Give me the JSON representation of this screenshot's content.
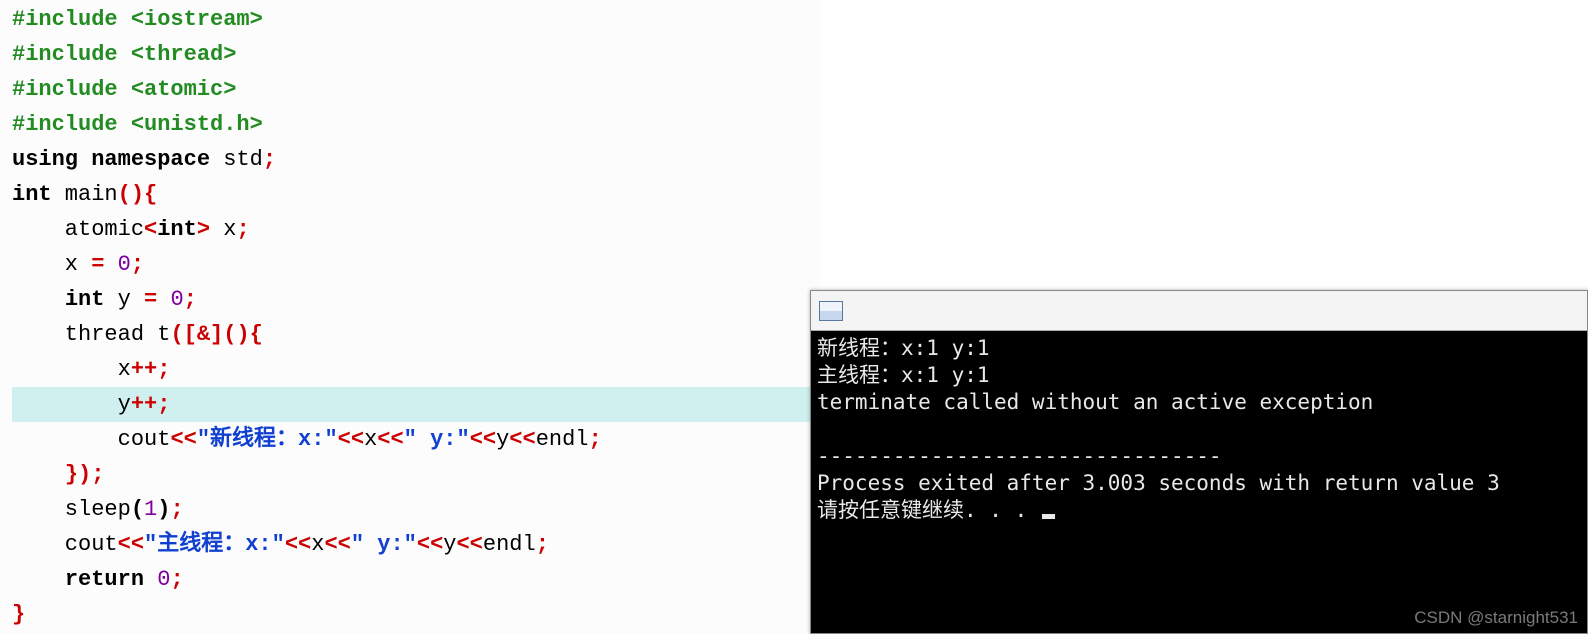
{
  "code": {
    "lines": [
      [
        {
          "cls": "t-preproc",
          "text": "#include <iostream>"
        }
      ],
      [
        {
          "cls": "t-preproc",
          "text": "#include <thread>"
        }
      ],
      [
        {
          "cls": "t-preproc",
          "text": "#include <atomic>"
        }
      ],
      [
        {
          "cls": "t-preproc",
          "text": "#include <unistd.h>"
        }
      ],
      [
        {
          "cls": "t-keyword",
          "text": "using namespace"
        },
        {
          "cls": "t-ident",
          "text": " std"
        },
        {
          "cls": "t-punc-red",
          "text": ";"
        }
      ],
      [
        {
          "cls": "t-keyword",
          "text": "int"
        },
        {
          "cls": "t-ident",
          "text": " main"
        },
        {
          "cls": "t-punc-red",
          "text": "(){"
        }
      ],
      [
        {
          "cls": "t-ident",
          "text": "    atomic"
        },
        {
          "cls": "t-punc-red",
          "text": "<"
        },
        {
          "cls": "t-keyword",
          "text": "int"
        },
        {
          "cls": "t-punc-red",
          "text": ">"
        },
        {
          "cls": "t-ident",
          "text": " x"
        },
        {
          "cls": "t-punc-red",
          "text": ";"
        }
      ],
      [
        {
          "cls": "t-ident",
          "text": "    x "
        },
        {
          "cls": "t-punc-red",
          "text": "="
        },
        {
          "cls": "t-ident",
          "text": " "
        },
        {
          "cls": "t-num",
          "text": "0"
        },
        {
          "cls": "t-punc-red",
          "text": ";"
        }
      ],
      [
        {
          "cls": "t-ident",
          "text": "    "
        },
        {
          "cls": "t-keyword",
          "text": "int"
        },
        {
          "cls": "t-ident",
          "text": " y "
        },
        {
          "cls": "t-punc-red",
          "text": "="
        },
        {
          "cls": "t-ident",
          "text": " "
        },
        {
          "cls": "t-num",
          "text": "0"
        },
        {
          "cls": "t-punc-red",
          "text": ";"
        }
      ],
      [
        {
          "cls": "t-ident",
          "text": "    thread t"
        },
        {
          "cls": "t-punc-red",
          "text": "([&](){"
        }
      ],
      [
        {
          "cls": "t-ident",
          "text": "        x"
        },
        {
          "cls": "t-punc-red",
          "text": "++;"
        }
      ],
      [
        {
          "cls": "t-ident",
          "text": "        y"
        },
        {
          "cls": "t-punc-red",
          "text": "++;"
        }
      ],
      [
        {
          "cls": "t-ident",
          "text": "        cout"
        },
        {
          "cls": "t-punc-red",
          "text": "<<"
        },
        {
          "cls": "t-string",
          "text": "\"新线程：x:\""
        },
        {
          "cls": "t-punc-red",
          "text": "<<"
        },
        {
          "cls": "t-ident",
          "text": "x"
        },
        {
          "cls": "t-punc-red",
          "text": "<<"
        },
        {
          "cls": "t-string",
          "text": "\" y:\""
        },
        {
          "cls": "t-punc-red",
          "text": "<<"
        },
        {
          "cls": "t-ident",
          "text": "y"
        },
        {
          "cls": "t-punc-red",
          "text": "<<"
        },
        {
          "cls": "t-ident",
          "text": "endl"
        },
        {
          "cls": "t-punc-red",
          "text": ";"
        }
      ],
      [
        {
          "cls": "t-ident",
          "text": "    "
        },
        {
          "cls": "t-punc-red",
          "text": "});"
        }
      ],
      [
        {
          "cls": "t-ident",
          "text": "    sleep"
        },
        {
          "cls": "t-brace-blk",
          "text": "("
        },
        {
          "cls": "t-num",
          "text": "1"
        },
        {
          "cls": "t-brace-blk",
          "text": ")"
        },
        {
          "cls": "t-punc-red",
          "text": ";"
        }
      ],
      [
        {
          "cls": "t-ident",
          "text": "    cout"
        },
        {
          "cls": "t-punc-red",
          "text": "<<"
        },
        {
          "cls": "t-string",
          "text": "\"主线程：x:\""
        },
        {
          "cls": "t-punc-red",
          "text": "<<"
        },
        {
          "cls": "t-ident",
          "text": "x"
        },
        {
          "cls": "t-punc-red",
          "text": "<<"
        },
        {
          "cls": "t-string",
          "text": "\" y:\""
        },
        {
          "cls": "t-punc-red",
          "text": "<<"
        },
        {
          "cls": "t-ident",
          "text": "y"
        },
        {
          "cls": "t-punc-red",
          "text": "<<"
        },
        {
          "cls": "t-ident",
          "text": "endl"
        },
        {
          "cls": "t-punc-red",
          "text": ";"
        }
      ],
      [
        {
          "cls": "t-ident",
          "text": "    "
        },
        {
          "cls": "t-keyword",
          "text": "return"
        },
        {
          "cls": "t-ident",
          "text": " "
        },
        {
          "cls": "t-num",
          "text": "0"
        },
        {
          "cls": "t-punc-red",
          "text": ";"
        }
      ],
      [
        {
          "cls": "t-brace-red",
          "text": "}"
        }
      ]
    ],
    "highlighted_index": 11
  },
  "terminal": {
    "line1": "新线程：x:1 y:1",
    "line2": "主线程：x:1 y:1",
    "line3": "terminate called without an active exception",
    "blank1": "",
    "sep": "--------------------------------",
    "line4": "Process exited after 3.003 seconds with return value 3",
    "line5": "请按任意键继续. . . "
  },
  "watermark": "CSDN @starnight531"
}
